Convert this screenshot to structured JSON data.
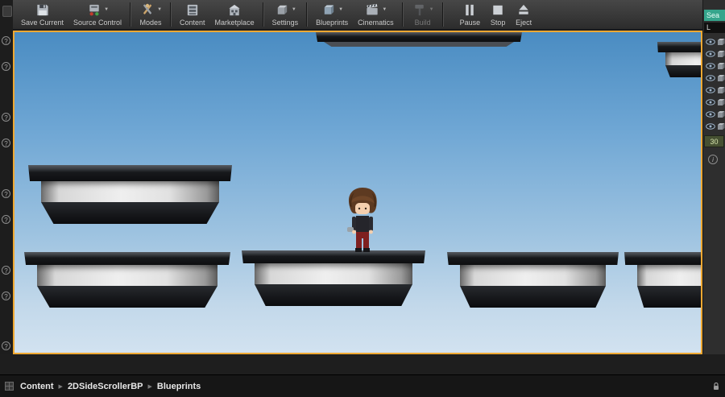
{
  "toolbar": {
    "items": [
      {
        "label": "Save Current",
        "icon": "save-icon"
      },
      {
        "label": "Source Control",
        "icon": "source-control-icon"
      },
      {
        "label": "Modes",
        "icon": "modes-icon"
      },
      {
        "label": "Content",
        "icon": "content-browser-icon"
      },
      {
        "label": "Marketplace",
        "icon": "marketplace-icon"
      },
      {
        "label": "Settings",
        "icon": "settings-icon"
      },
      {
        "label": "Blueprints",
        "icon": "blueprints-icon"
      },
      {
        "label": "Cinematics",
        "icon": "cinematics-icon"
      },
      {
        "label": "Build",
        "icon": "build-icon"
      },
      {
        "label": "Pause",
        "icon": "pause-icon"
      },
      {
        "label": "Stop",
        "icon": "stop-icon"
      },
      {
        "label": "Eject",
        "icon": "eject-icon"
      }
    ]
  },
  "right_panel": {
    "search_text": "Sea",
    "header": "L",
    "value": "30"
  },
  "breadcrumb": {
    "items": [
      "Content",
      "2DSideScrollerBP",
      "Blueprints"
    ]
  },
  "colors": {
    "viewport_border": "#efa832",
    "sky_top": "#4a8cc2",
    "sky_bottom": "#d2e2f0",
    "search_accent": "#35a58c",
    "pants_red": "#7e2020",
    "hair_brown": "#5d3a21"
  }
}
